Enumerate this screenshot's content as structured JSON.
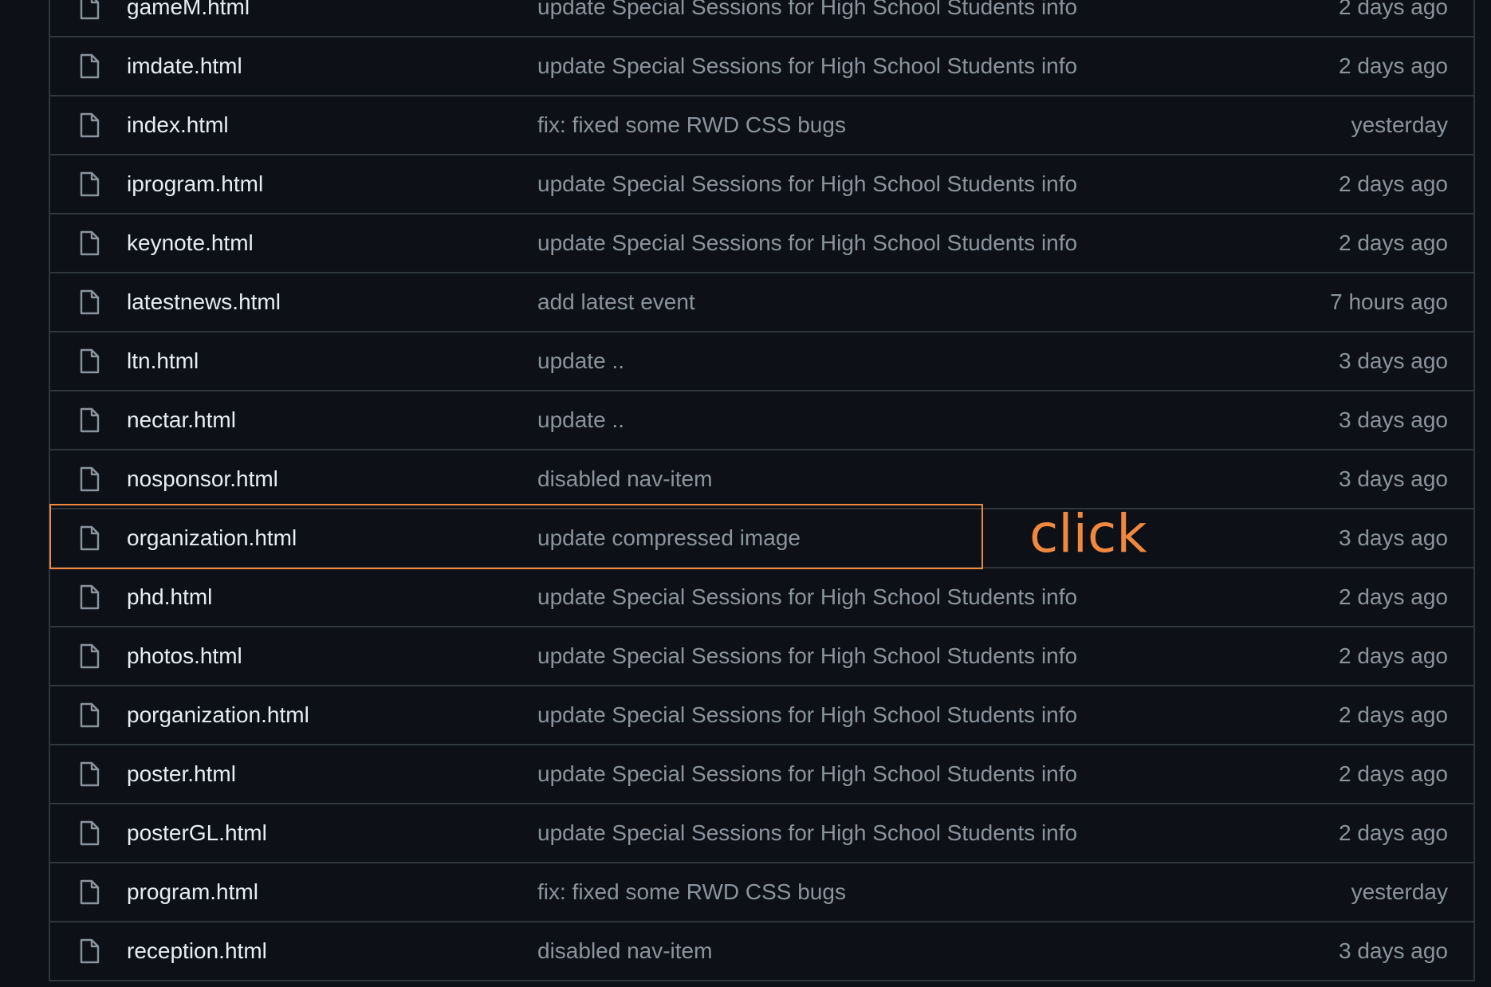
{
  "files": [
    {
      "name": "gameM.html",
      "message": "update Special Sessions for High School Students info",
      "time": "2 days ago"
    },
    {
      "name": "imdate.html",
      "message": "update Special Sessions for High School Students info",
      "time": "2 days ago"
    },
    {
      "name": "index.html",
      "message": "fix: fixed some RWD CSS bugs",
      "time": "yesterday"
    },
    {
      "name": "iprogram.html",
      "message": "update Special Sessions for High School Students info",
      "time": "2 days ago"
    },
    {
      "name": "keynote.html",
      "message": "update Special Sessions for High School Students info",
      "time": "2 days ago"
    },
    {
      "name": "latestnews.html",
      "message": "add latest event",
      "time": "7 hours ago"
    },
    {
      "name": "ltn.html",
      "message": "update ..",
      "time": "3 days ago"
    },
    {
      "name": "nectar.html",
      "message": "update ..",
      "time": "3 days ago"
    },
    {
      "name": "nosponsor.html",
      "message": "disabled nav-item",
      "time": "3 days ago"
    },
    {
      "name": "organization.html",
      "message": "update compressed image",
      "time": "3 days ago"
    },
    {
      "name": "phd.html",
      "message": "update Special Sessions for High School Students info",
      "time": "2 days ago"
    },
    {
      "name": "photos.html",
      "message": "update Special Sessions for High School Students info",
      "time": "2 days ago"
    },
    {
      "name": "porganization.html",
      "message": "update Special Sessions for High School Students info",
      "time": "2 days ago"
    },
    {
      "name": "poster.html",
      "message": "update Special Sessions for High School Students info",
      "time": "2 days ago"
    },
    {
      "name": "posterGL.html",
      "message": "update Special Sessions for High School Students info",
      "time": "2 days ago"
    },
    {
      "name": "program.html",
      "message": "fix: fixed some RWD CSS bugs",
      "time": "yesterday"
    },
    {
      "name": "reception.html",
      "message": "disabled nav-item",
      "time": "3 days ago"
    }
  ],
  "annotation": {
    "label": "click",
    "color": "#f0883e"
  },
  "icons": {
    "file": "file-icon"
  },
  "colors": {
    "background": "#0d1117",
    "border": "#30363d",
    "file_name": "#e6edf3",
    "secondary_text": "#8b949e"
  }
}
